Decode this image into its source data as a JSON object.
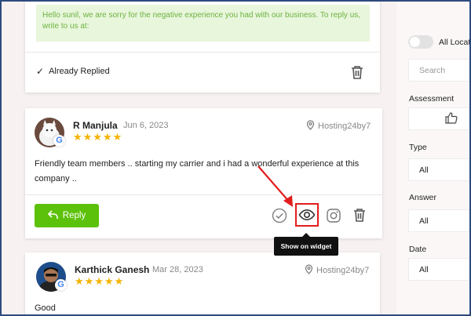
{
  "top_card": {
    "reply_text": "Hello sunil, we are sorry for the negative experience you had with our business. To reply us, write to us at:",
    "status": "Already Replied"
  },
  "review": {
    "name": "R Manjula",
    "date": "Jun 6, 2023",
    "location": "Hosting24by7",
    "stars": "★★★★★",
    "rating": 5,
    "text": "Friendly team members .. starting my carrier and i had a wonderful experience at this company ..",
    "reply_label": "Reply",
    "tooltip": "Show on widget"
  },
  "review2": {
    "name": "Karthick Ganesh",
    "date": "Mar 28, 2023",
    "location": "Hosting24by7",
    "stars": "★★★★★",
    "rating": 5,
    "text": "Good"
  },
  "sidebar": {
    "toggle_label": "All Locat",
    "search_placeholder": "Search",
    "assessment_label": "Assessment",
    "type_label": "Type",
    "type_value": "All",
    "answer_label": "Answer",
    "answer_value": "All",
    "date_label": "Date",
    "date_value": "All"
  },
  "colors": {
    "accent_green": "#5cc10a",
    "star": "#f5b301",
    "highlight_red": "#e21d1d"
  }
}
